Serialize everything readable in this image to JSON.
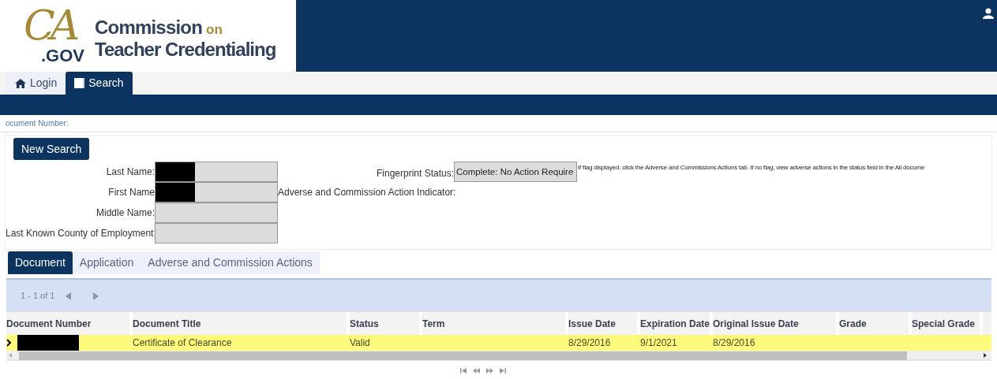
{
  "logo": {
    "mark": "CA",
    "suffix": ".GOV",
    "title_main": "Commission",
    "title_on": "on",
    "title_line2": "Teacher Credentialing"
  },
  "nav_tabs": [
    {
      "label": "Login",
      "selected": false
    },
    {
      "label": "Search",
      "selected": true
    }
  ],
  "document_number_label": "ocument Number:",
  "new_search_button": "New Search",
  "person_fields": [
    {
      "label": "Last Name:",
      "redacted": true
    },
    {
      "label": "First Name",
      "redacted": true
    },
    {
      "label": "Middle Name:",
      "redacted": false
    },
    {
      "label": "Last Known County of Employment:",
      "redacted": false
    }
  ],
  "fingerprint": {
    "label": "Fingerprint Status:",
    "value": "Complete: No Action Require",
    "note": "If flag displayed, click the Adverse and Commissions Actions tab. If no flag, view adverse actions in the status field in the All docume"
  },
  "adverse_indicator_label": "Adverse and Commission Action Indicator:",
  "result_tabs": [
    {
      "label": "Document",
      "selected": true
    },
    {
      "label": "Application",
      "selected": false
    },
    {
      "label": "Adverse and Commission Actions",
      "selected": false
    }
  ],
  "pager": {
    "summary": "1 - 1 of 1"
  },
  "table": {
    "columns": [
      "Document Number",
      "Document Title",
      "Status",
      "Term",
      "Issue Date",
      "Expiration Date",
      "Original Issue Date",
      "Grade",
      "Special Grade"
    ],
    "rows": [
      {
        "selected": true,
        "number_redacted": true,
        "cells": [
          "",
          "Certificate of Clearance",
          "Valid",
          "",
          "8/29/2016",
          "9/1/2021",
          "8/29/2016",
          "",
          ""
        ]
      }
    ]
  }
}
